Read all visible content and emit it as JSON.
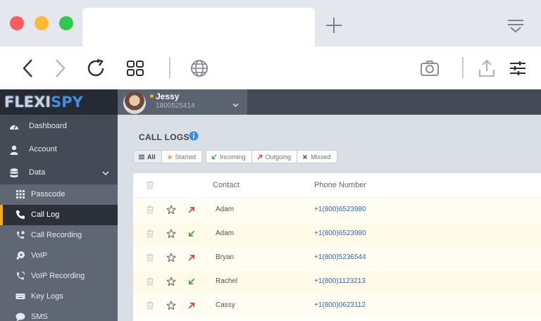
{
  "app": {
    "logo_part1": "FLEXI",
    "logo_part2": "SPY"
  },
  "user": {
    "name": "Jessy",
    "phone": "1800525414"
  },
  "sidebar": {
    "items": [
      {
        "label": "Dashboard",
        "icon": "dashboard-icon"
      },
      {
        "label": "Account",
        "icon": "user-icon"
      },
      {
        "label": "Data",
        "icon": "database-icon"
      }
    ],
    "sub_items": [
      {
        "label": "Passcode",
        "icon": "keypad-icon"
      },
      {
        "label": "Call Log",
        "icon": "phone-icon",
        "active": true
      },
      {
        "label": "Call Recording",
        "icon": "phone-record-icon"
      },
      {
        "label": "VoIP",
        "icon": "voip-icon"
      },
      {
        "label": "VoIP Recording",
        "icon": "voip-record-icon"
      },
      {
        "label": "Key Logs",
        "icon": "keyboard-icon"
      },
      {
        "label": "SMS",
        "icon": "chat-icon"
      }
    ]
  },
  "page": {
    "title": "CALL LOGS"
  },
  "filters": {
    "group1": [
      {
        "label": "All",
        "active": true
      },
      {
        "label": "Starred"
      }
    ],
    "group2": [
      {
        "label": "Incoming"
      },
      {
        "label": "Outgoing"
      },
      {
        "label": "Missed"
      }
    ]
  },
  "table": {
    "columns": {
      "contact": "Contact",
      "phone": "Phone Number"
    },
    "rows": [
      {
        "direction": "outgoing",
        "contact": "Adam",
        "phone": "+1(800)6523980"
      },
      {
        "direction": "incoming",
        "contact": "Adam",
        "phone": "+1(800)6523980"
      },
      {
        "direction": "outgoing",
        "contact": "Bryan",
        "phone": "+1(800)5236544"
      },
      {
        "direction": "incoming",
        "contact": "Rachel",
        "phone": "+1(800)1123213"
      },
      {
        "direction": "outgoing",
        "contact": "Cassy",
        "phone": "+1(800)0623112"
      }
    ]
  },
  "colors": {
    "accent": "#f5a623",
    "incoming": "#3cae45",
    "outgoing": "#e2473a",
    "link": "#2f67b2"
  }
}
